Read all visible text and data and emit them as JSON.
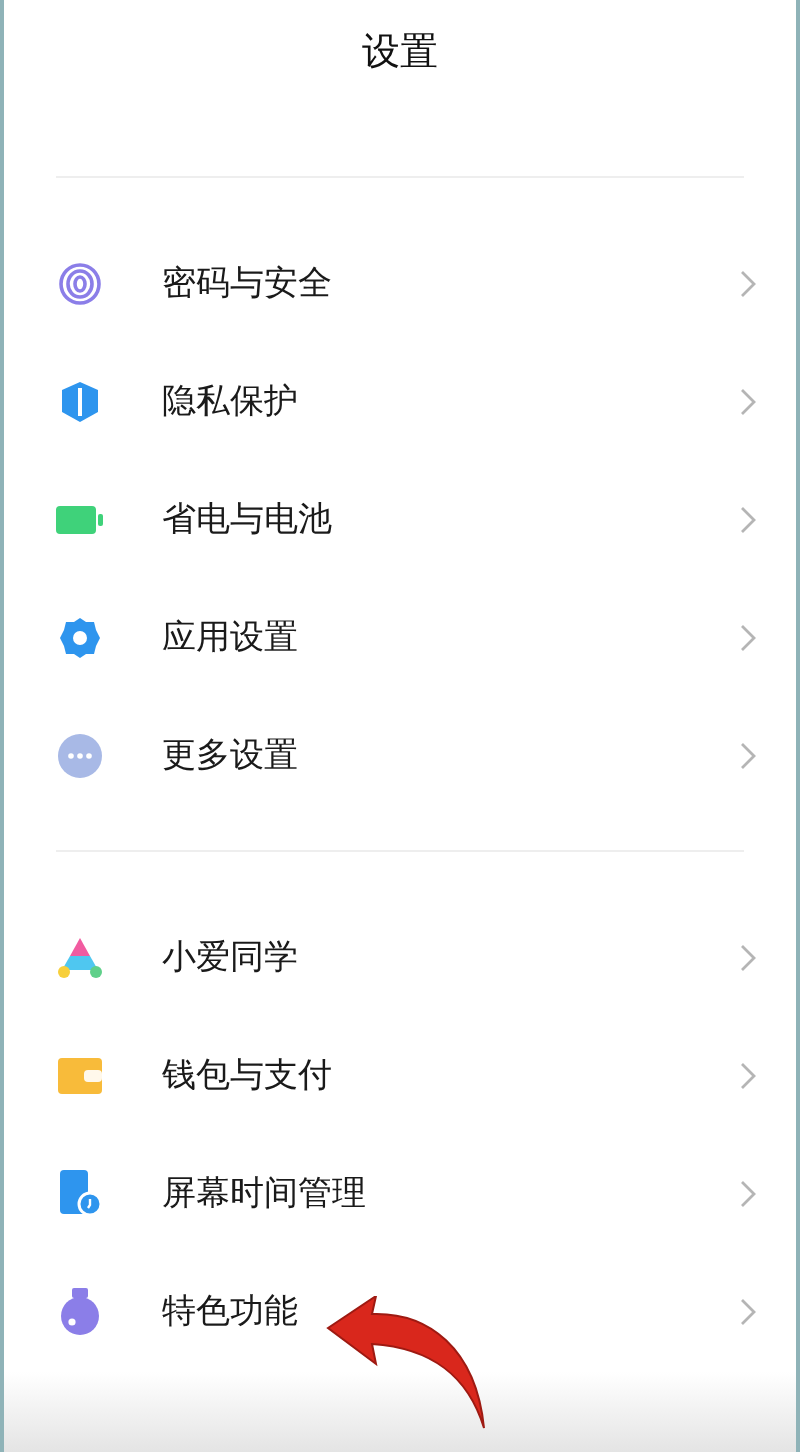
{
  "header": {
    "title": "设置"
  },
  "sections": [
    {
      "items": [
        {
          "label": "密码与安全"
        },
        {
          "label": "隐私保护"
        },
        {
          "label": "省电与电池"
        },
        {
          "label": "应用设置"
        },
        {
          "label": "更多设置"
        }
      ]
    },
    {
      "items": [
        {
          "label": "小爱同学"
        },
        {
          "label": "钱包与支付"
        },
        {
          "label": "屏幕时间管理"
        },
        {
          "label": "特色功能"
        }
      ]
    }
  ]
}
